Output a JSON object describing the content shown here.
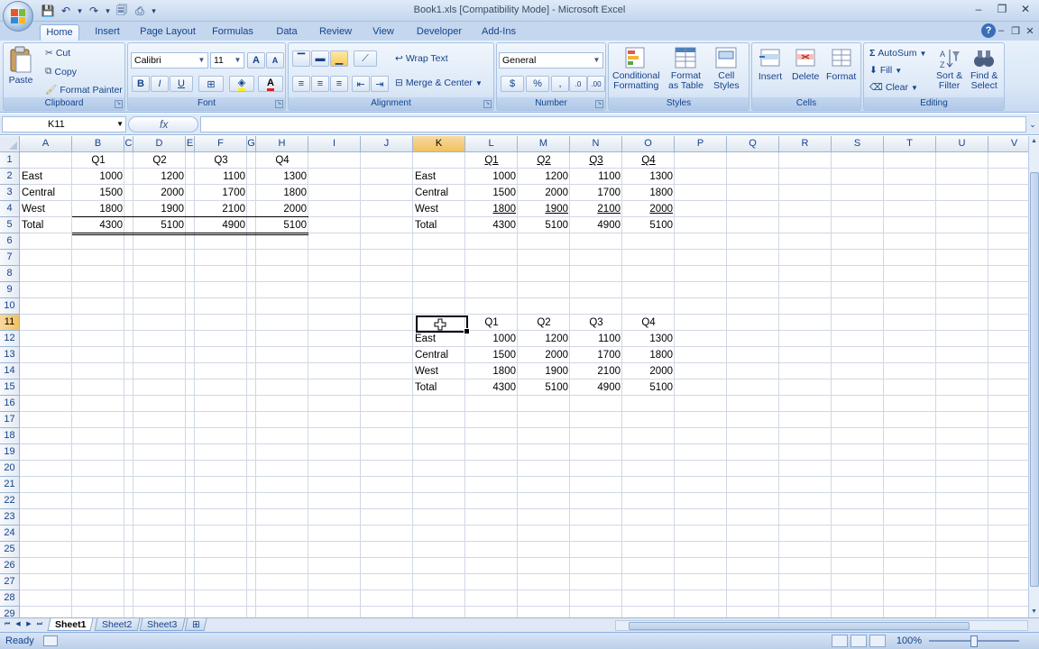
{
  "window": {
    "title": "Book1.xls  [Compatibility Mode] - Microsoft Excel",
    "min": "–",
    "restore": "❐",
    "close": "✕"
  },
  "qat": [
    {
      "name": "save-icon",
      "glyph": "💾"
    },
    {
      "name": "undo-icon",
      "glyph": "↶"
    },
    {
      "name": "undo-dropdown-icon",
      "glyph": "▾"
    },
    {
      "name": "redo-icon",
      "glyph": "↷"
    },
    {
      "name": "redo-dropdown-icon",
      "glyph": "▾"
    },
    {
      "name": "print-preview-icon",
      "glyph": "🗐"
    },
    {
      "name": "print-icon",
      "glyph": "⎙"
    },
    {
      "name": "customize-qat-icon",
      "glyph": "▾"
    }
  ],
  "tabs": [
    {
      "label": "Home",
      "active": true
    },
    {
      "label": "Insert"
    },
    {
      "label": "Page Layout"
    },
    {
      "label": "Formulas"
    },
    {
      "label": "Data"
    },
    {
      "label": "Review"
    },
    {
      "label": "View"
    },
    {
      "label": "Developer"
    },
    {
      "label": "Add-Ins"
    }
  ],
  "ribbon": {
    "clipboard": {
      "label": "Clipboard",
      "paste": "Paste",
      "cut": "Cut",
      "copy": "Copy",
      "format_painter": "Format Painter"
    },
    "font": {
      "label": "Font",
      "font_name": "Calibri",
      "font_size": "11",
      "bold": "B",
      "italic": "I",
      "underline": "U",
      "grow": "A",
      "shrink": "A",
      "font_color": "A"
    },
    "alignment": {
      "label": "Alignment",
      "wrap_text": "Wrap Text",
      "merge_center": "Merge & Center"
    },
    "number": {
      "label": "Number",
      "format": "General",
      "currency": "$",
      "percent": "%",
      "comma": ","
    },
    "styles": {
      "label": "Styles",
      "conditional": "Conditional",
      "conditional2": "Formatting",
      "format_table": "Format",
      "format_table2": "as Table",
      "cell_styles": "Cell",
      "cell_styles2": "Styles"
    },
    "cells": {
      "label": "Cells",
      "insert": "Insert",
      "delete": "Delete",
      "format": "Format"
    },
    "editing": {
      "label": "Editing",
      "autosum": "AutoSum",
      "fill": "Fill",
      "clear": "Clear",
      "sort": "Sort &",
      "sort2": "Filter",
      "find": "Find &",
      "find2": "Select"
    }
  },
  "formula_bar": {
    "name_box": "K11",
    "fx": "fx",
    "content": ""
  },
  "columns": [
    "A",
    "B",
    "C",
    "D",
    "E",
    "F",
    "G",
    "H",
    "I",
    "J",
    "K",
    "L",
    "M",
    "N",
    "O",
    "P",
    "Q",
    "R",
    "S",
    "T",
    "U",
    "V"
  ],
  "selected_column": "K",
  "rows": [
    "1",
    "2",
    "3",
    "4",
    "5",
    "6",
    "7",
    "8",
    "9",
    "10",
    "11",
    "12",
    "13",
    "14",
    "15",
    "16",
    "17",
    "18",
    "19",
    "20",
    "21",
    "22",
    "23",
    "24",
    "25",
    "26",
    "27",
    "28",
    "29"
  ],
  "selected_row": "11",
  "table1": {
    "headers": [
      "Q1",
      "Q2",
      "Q3",
      "Q4"
    ],
    "rows": [
      {
        "label": "East",
        "values": [
          "1000",
          "1200",
          "1100",
          "1300"
        ]
      },
      {
        "label": "Central",
        "values": [
          "1500",
          "2000",
          "1700",
          "1800"
        ]
      },
      {
        "label": "West",
        "values": [
          "1800",
          "1900",
          "2100",
          "2000"
        ]
      },
      {
        "label": "Total",
        "values": [
          "4300",
          "5100",
          "4900",
          "5100"
        ]
      }
    ]
  },
  "table2": {
    "headers": [
      "Q1",
      "Q2",
      "Q3",
      "Q4"
    ],
    "rows": [
      {
        "label": "East",
        "values": [
          "1000",
          "1200",
          "1100",
          "1300"
        ]
      },
      {
        "label": "Central",
        "values": [
          "1500",
          "2000",
          "1700",
          "1800"
        ]
      },
      {
        "label": "West",
        "values": [
          "1800",
          "1900",
          "2100",
          "2000"
        ]
      },
      {
        "label": "Total",
        "values": [
          "4300",
          "5100",
          "4900",
          "5100"
        ]
      }
    ]
  },
  "table3": {
    "headers": [
      "Q1",
      "Q2",
      "Q3",
      "Q4"
    ],
    "rows": [
      {
        "label": "East",
        "values": [
          "1000",
          "1200",
          "1100",
          "1300"
        ]
      },
      {
        "label": "Central",
        "values": [
          "1500",
          "2000",
          "1700",
          "1800"
        ]
      },
      {
        "label": "West",
        "values": [
          "1800",
          "1900",
          "2100",
          "2000"
        ]
      },
      {
        "label": "Total",
        "values": [
          "4300",
          "5100",
          "4900",
          "5100"
        ]
      }
    ]
  },
  "sheets": [
    {
      "label": "Sheet1",
      "active": true
    },
    {
      "label": "Sheet2"
    },
    {
      "label": "Sheet3"
    }
  ],
  "status": {
    "ready": "Ready",
    "zoom": "100%"
  },
  "colors": {
    "accent": "#15428b",
    "ribbon": "#dbe8f7",
    "selected_header": "#f1c15f"
  }
}
